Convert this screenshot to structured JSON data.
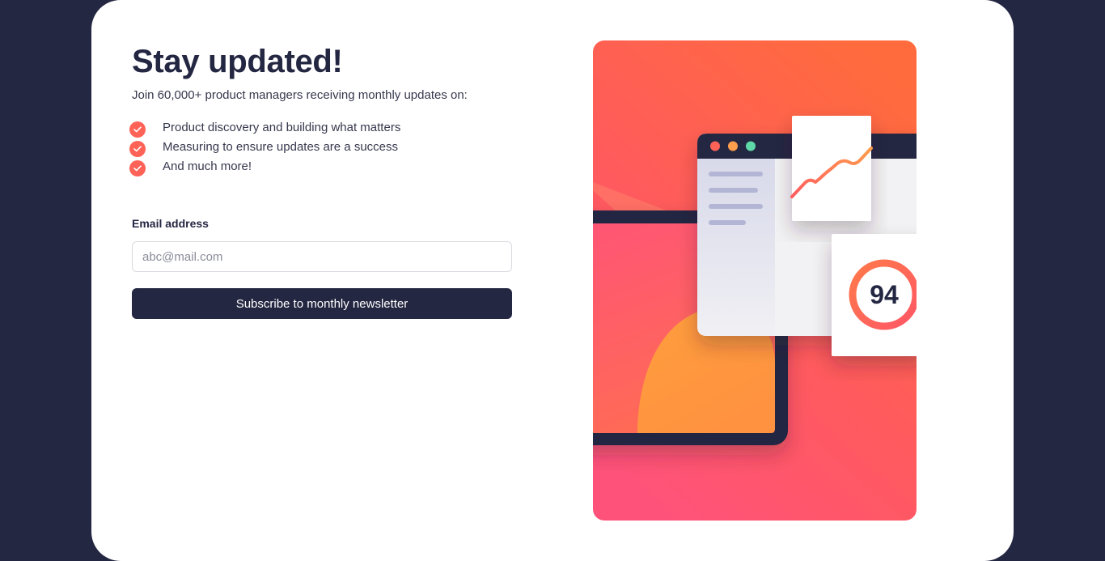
{
  "signup": {
    "title": "Stay updated!",
    "intro": "Join 60,000+ product managers receiving monthly updates on:",
    "benefits": [
      "Product discovery and building what matters",
      "Measuring to ensure updates are a success",
      "And much more!"
    ],
    "email_label": "Email address",
    "email_placeholder": "abc@mail.com",
    "email_value": "",
    "subscribe_label": "Subscribe to monthly newsletter"
  },
  "illustration": {
    "score": "94"
  },
  "colors": {
    "page_background": "#242742",
    "card_background": "#ffffff",
    "primary_dark": "#242742",
    "accent_tomato": "#ff6257",
    "text": "#36384d"
  },
  "icons": {
    "check": "check-circle-icon",
    "window_dots": "window-dots-icon",
    "trend": "trend-line-icon"
  }
}
